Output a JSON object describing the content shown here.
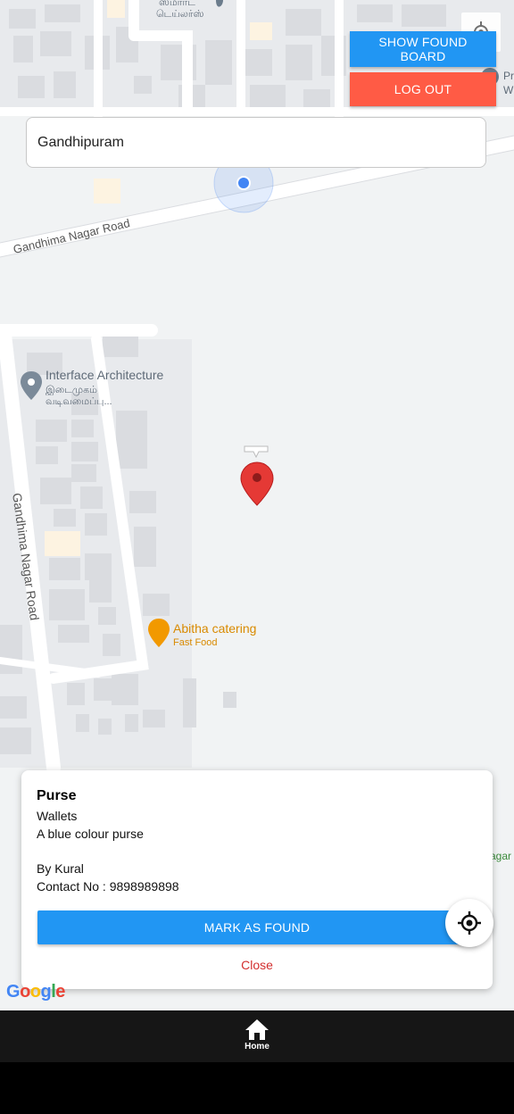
{
  "top_buttons": {
    "show_found_board": "SHOW FOUND BOARD",
    "logout": "LOG OUT"
  },
  "search": {
    "value": "Gandhipuram"
  },
  "map": {
    "labels": {
      "road_top": "Gandhima Nagar Road",
      "road_left": "Gandhima Nagar Road",
      "poi_architecture": "Interface Architecture",
      "poi_architecture_tamil_1": "இடைமுகம்",
      "poi_architecture_tamil_2": "வடிவமைப்பு...",
      "poi_catering": "Abitha catering",
      "poi_catering_sub": "Fast Food",
      "poi_top_tamil_1": "ஸ்மார்ட்",
      "poi_top_tamil_2": "டெய்லர்ஸ்",
      "poi_right_1": "Pr",
      "poi_right_2": "W",
      "poi_right_bottom": "agar"
    }
  },
  "card": {
    "title": "Purse",
    "category": "Wallets",
    "description": "A blue colour purse",
    "by": "By Kural",
    "contact": "Contact No : 9898989898",
    "mark_found": "MARK AS FOUND",
    "close": "Close"
  },
  "google_logo": "Google",
  "bottom_nav": {
    "home_label": "Home"
  },
  "colors": {
    "primary_blue": "#2196f3",
    "logout_red": "#ff5b45",
    "close_red": "#d32f2f",
    "marker_red": "#e53935"
  }
}
